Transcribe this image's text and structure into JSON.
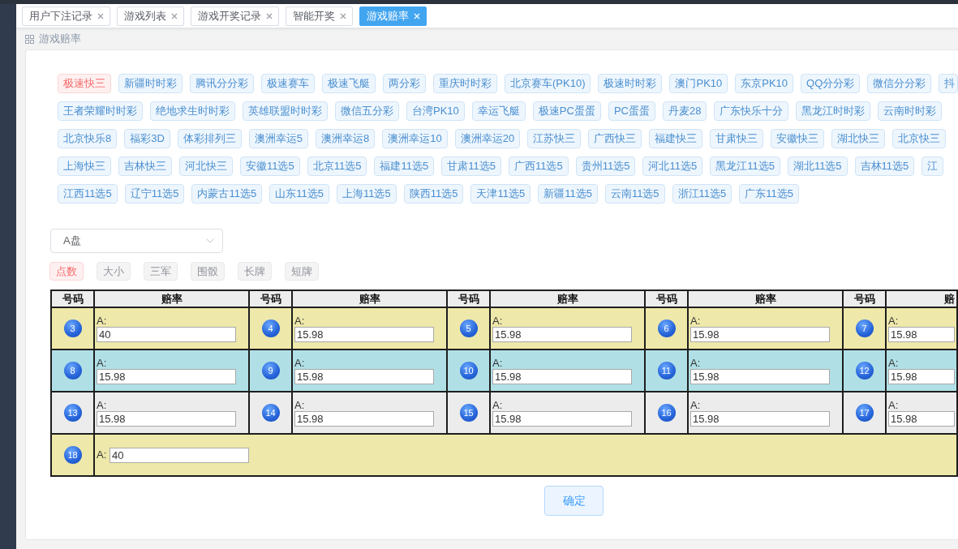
{
  "tabs": [
    {
      "label": "用户下注记录",
      "selected": false
    },
    {
      "label": "游戏列表",
      "selected": false
    },
    {
      "label": "游戏开奖记录",
      "selected": false
    },
    {
      "label": "智能开奖",
      "selected": false
    },
    {
      "label": "游戏赔率",
      "selected": true
    }
  ],
  "breadcrumb": {
    "title": "游戏赔率"
  },
  "game_tag_rows": [
    {
      "tags": [
        {
          "label": "极速快三",
          "selected": true
        },
        {
          "label": "新疆时时彩",
          "selected": false
        },
        {
          "label": "腾讯分分彩",
          "selected": false
        },
        {
          "label": "极速赛车",
          "selected": false
        },
        {
          "label": "极速飞艇",
          "selected": false
        },
        {
          "label": "两分彩",
          "selected": false
        },
        {
          "label": "重庆时时彩",
          "selected": false
        },
        {
          "label": "北京赛车(PK10)",
          "selected": false
        },
        {
          "label": "极速时时彩",
          "selected": false
        },
        {
          "label": "澳门PK10",
          "selected": false
        },
        {
          "label": "东京PK10",
          "selected": false
        },
        {
          "label": "QQ分分彩",
          "selected": false
        },
        {
          "label": "微信分分彩",
          "selected": false
        },
        {
          "label": "抖",
          "selected": false
        }
      ]
    },
    {
      "tags": [
        {
          "label": "王者荣耀时时彩",
          "selected": false
        },
        {
          "label": "绝地求生时时彩",
          "selected": false
        },
        {
          "label": "英雄联盟时时彩",
          "selected": false
        },
        {
          "label": "微信五分彩",
          "selected": false
        },
        {
          "label": "台湾PK10",
          "selected": false
        },
        {
          "label": "幸运飞艇",
          "selected": false
        },
        {
          "label": "极速PC蛋蛋",
          "selected": false
        },
        {
          "label": "PC蛋蛋",
          "selected": false
        },
        {
          "label": "丹麦28",
          "selected": false
        },
        {
          "label": "广东快乐十分",
          "selected": false
        },
        {
          "label": "黑龙江时时彩",
          "selected": false
        },
        {
          "label": "云南时时彩",
          "selected": false
        }
      ]
    },
    {
      "tags": [
        {
          "label": "北京快乐8",
          "selected": false
        },
        {
          "label": "福彩3D",
          "selected": false
        },
        {
          "label": "体彩排列三",
          "selected": false
        },
        {
          "label": "澳洲幸运5",
          "selected": false
        },
        {
          "label": "澳洲幸运8",
          "selected": false
        },
        {
          "label": "澳洲幸运10",
          "selected": false
        },
        {
          "label": "澳洲幸运20",
          "selected": false
        },
        {
          "label": "江苏快三",
          "selected": false
        },
        {
          "label": "广西快三",
          "selected": false
        },
        {
          "label": "福建快三",
          "selected": false
        },
        {
          "label": "甘肃快三",
          "selected": false
        },
        {
          "label": "安徽快三",
          "selected": false
        },
        {
          "label": "湖北快三",
          "selected": false
        },
        {
          "label": "北京快三",
          "selected": false
        }
      ]
    },
    {
      "tags": [
        {
          "label": "上海快三",
          "selected": false
        },
        {
          "label": "吉林快三",
          "selected": false
        },
        {
          "label": "河北快三",
          "selected": false
        },
        {
          "label": "安徽11选5",
          "selected": false
        },
        {
          "label": "北京11选5",
          "selected": false
        },
        {
          "label": "福建11选5",
          "selected": false
        },
        {
          "label": "甘肃11选5",
          "selected": false
        },
        {
          "label": "广西11选5",
          "selected": false
        },
        {
          "label": "贵州11选5",
          "selected": false
        },
        {
          "label": "河北11选5",
          "selected": false
        },
        {
          "label": "黑龙江11选5",
          "selected": false
        },
        {
          "label": "湖北11选5",
          "selected": false
        },
        {
          "label": "吉林11选5",
          "selected": false
        },
        {
          "label": "江",
          "selected": false
        }
      ]
    },
    {
      "tags": [
        {
          "label": "江西11选5",
          "selected": false
        },
        {
          "label": "辽宁11选5",
          "selected": false
        },
        {
          "label": "内蒙古11选5",
          "selected": false
        },
        {
          "label": "山东11选5",
          "selected": false
        },
        {
          "label": "上海11选5",
          "selected": false
        },
        {
          "label": "陕西11选5",
          "selected": false
        },
        {
          "label": "天津11选5",
          "selected": false
        },
        {
          "label": "新疆11选5",
          "selected": false
        },
        {
          "label": "云南11选5",
          "selected": false
        },
        {
          "label": "浙江11选5",
          "selected": false
        },
        {
          "label": "广东11选5",
          "selected": false
        }
      ]
    }
  ],
  "plate_select": {
    "value": "A盘"
  },
  "play_tabs": [
    {
      "label": "点数",
      "selected": true
    },
    {
      "label": "大小",
      "selected": false
    },
    {
      "label": "三军",
      "selected": false
    },
    {
      "label": "围骰",
      "selected": false
    },
    {
      "label": "长牌",
      "selected": false
    },
    {
      "label": "短牌",
      "selected": false
    }
  ],
  "odds_table": {
    "columns": [
      "号码",
      "赔率",
      "号码",
      "赔率",
      "号码",
      "赔率",
      "号码",
      "赔率",
      "号码",
      "赔"
    ],
    "rows": [
      {
        "color": "#eee8aa",
        "cells": [
          {
            "kind": "number",
            "number": "3"
          },
          {
            "kind": "odds",
            "label": "A:",
            "value": "40"
          },
          {
            "kind": "number",
            "number": "4"
          },
          {
            "kind": "odds",
            "label": "A:",
            "value": "15.98"
          },
          {
            "kind": "number",
            "number": "5"
          },
          {
            "kind": "odds",
            "label": "A:",
            "value": "15.98"
          },
          {
            "kind": "number",
            "number": "6"
          },
          {
            "kind": "odds",
            "label": "A:",
            "value": "15.98"
          },
          {
            "kind": "number",
            "number": "7"
          },
          {
            "kind": "odds",
            "label": "A:",
            "value": "15.98"
          }
        ]
      },
      {
        "color": "#b0e0e6",
        "cells": [
          {
            "kind": "number",
            "number": "8"
          },
          {
            "kind": "odds",
            "label": "A:",
            "value": "15.98"
          },
          {
            "kind": "number",
            "number": "9"
          },
          {
            "kind": "odds",
            "label": "A:",
            "value": "15.98"
          },
          {
            "kind": "number",
            "number": "10"
          },
          {
            "kind": "odds",
            "label": "A:",
            "value": "15.98"
          },
          {
            "kind": "number",
            "number": "11"
          },
          {
            "kind": "odds",
            "label": "A:",
            "value": "15.98"
          },
          {
            "kind": "number",
            "number": "12"
          },
          {
            "kind": "odds",
            "label": "A:",
            "value": "15.98"
          }
        ]
      },
      {
        "color": "#ececec",
        "cells": [
          {
            "kind": "number",
            "number": "13"
          },
          {
            "kind": "odds",
            "label": "A:",
            "value": "15.98"
          },
          {
            "kind": "number",
            "number": "14"
          },
          {
            "kind": "odds",
            "label": "A:",
            "value": "15.98"
          },
          {
            "kind": "number",
            "number": "15"
          },
          {
            "kind": "odds",
            "label": "A:",
            "value": "15.98"
          },
          {
            "kind": "number",
            "number": "16"
          },
          {
            "kind": "odds",
            "label": "A:",
            "value": "15.98"
          },
          {
            "kind": "number",
            "number": "17"
          },
          {
            "kind": "odds",
            "label": "A:",
            "value": "15.98"
          }
        ]
      },
      {
        "color": "#eee8aa",
        "cells": [
          {
            "kind": "number",
            "number": "18"
          },
          {
            "kind": "odds",
            "label": "A:",
            "value": "40",
            "colspan": 9
          }
        ]
      }
    ]
  },
  "confirm_button": "确定"
}
